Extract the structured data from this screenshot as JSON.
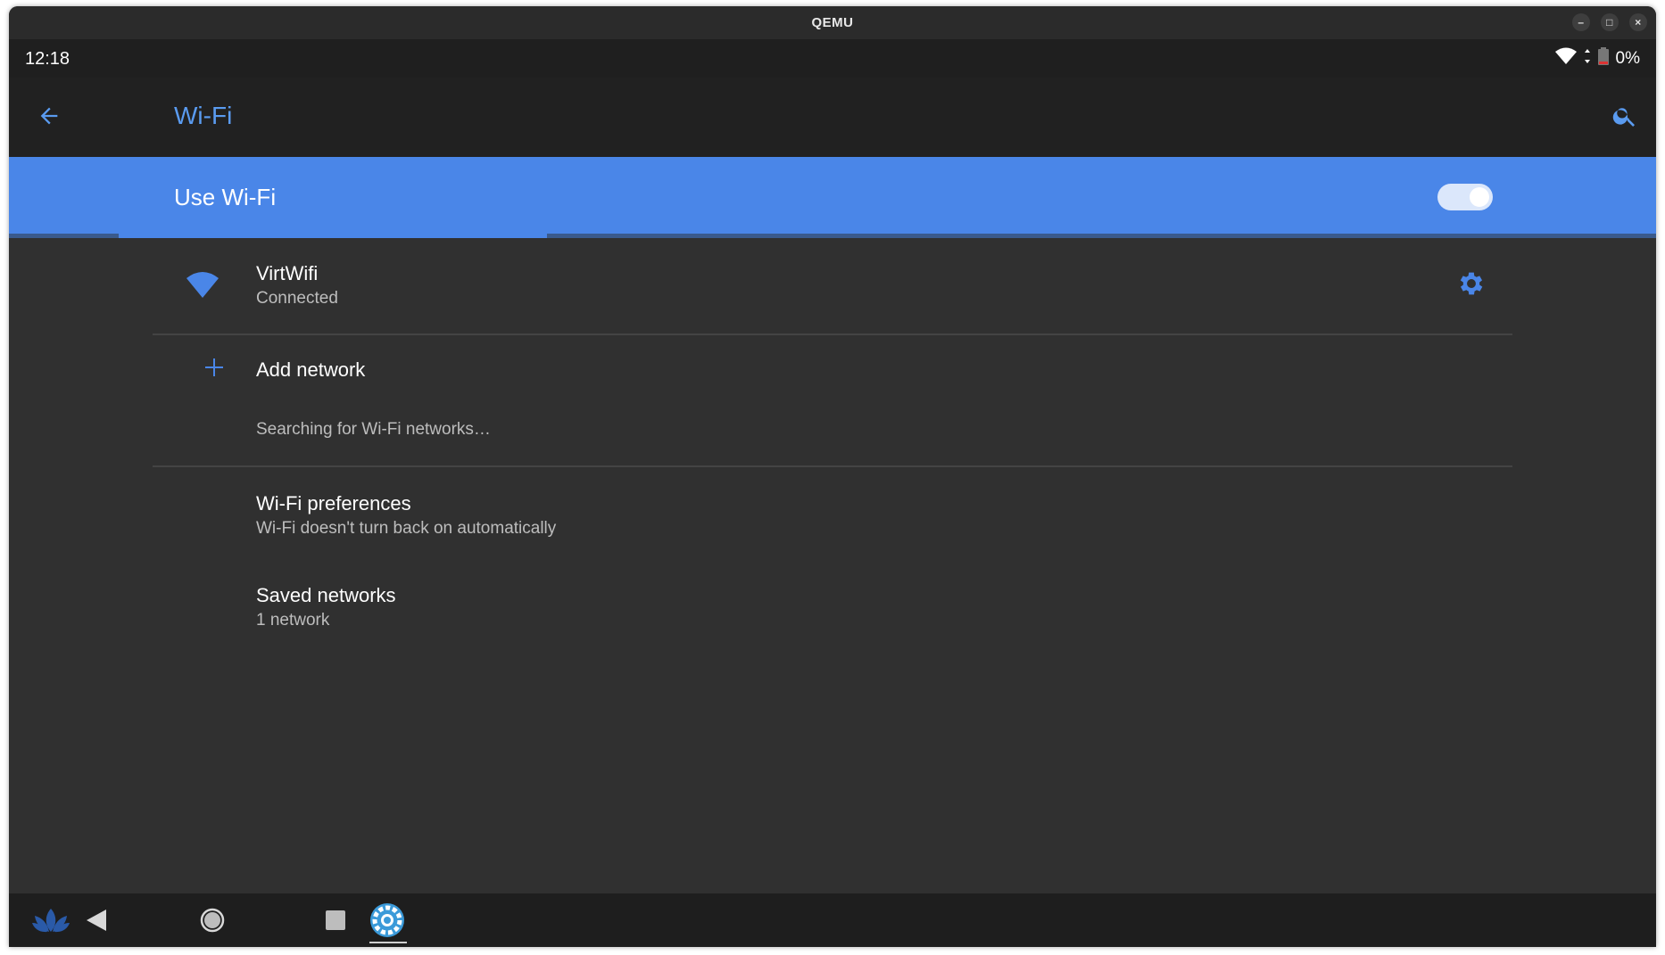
{
  "window": {
    "title": "QEMU",
    "controls": {
      "minimize": "–",
      "maximize": "□",
      "close": "×"
    }
  },
  "status_bar": {
    "time": "12:18",
    "battery": "0%",
    "icons": [
      "wifi-signal-icon",
      "data-arrows-icon",
      "battery-icon"
    ]
  },
  "app_bar": {
    "title": "Wi-Fi",
    "back_icon": "arrow-back-icon",
    "search_icon": "search-icon"
  },
  "master_switch": {
    "label": "Use Wi-Fi",
    "on": true
  },
  "networks": [
    {
      "name": "VirtWifi",
      "status": "Connected",
      "icon": "wifi-icon",
      "settings_icon": "gear-icon"
    }
  ],
  "add_network": {
    "label": "Add network",
    "icon": "plus-icon"
  },
  "scan_status": "Searching for Wi-Fi networks…",
  "preferences": {
    "title": "Wi-Fi preferences",
    "summary": "Wi-Fi doesn't turn back on automatically"
  },
  "saved_networks": {
    "title": "Saved networks",
    "summary": "1 network"
  },
  "nav_bar": {
    "items": [
      "lotus-launcher-icon",
      "back-triangle-icon",
      "home-circle-icon",
      "recents-square-icon",
      "settings-app-icon"
    ]
  },
  "colors": {
    "accent": "#4a86e8",
    "background": "#303030",
    "app_bar": "#212121"
  }
}
